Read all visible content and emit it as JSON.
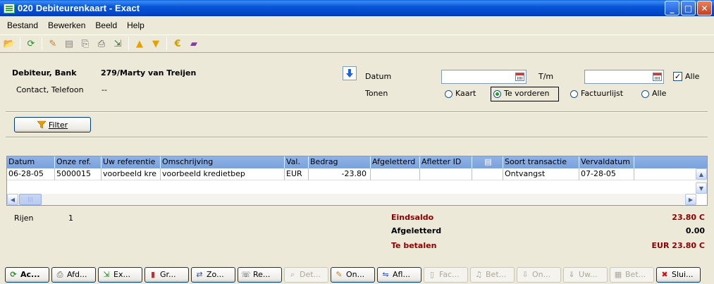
{
  "window": {
    "title": "020 Debiteurenkaart - Exact"
  },
  "menu": [
    "Bestand",
    "Bewerken",
    "Beeld",
    "Help"
  ],
  "header": {
    "debiteur_label": "Debiteur, Bank",
    "debiteur_value": "279/Marty van Treijen",
    "contact_label": "Contact, Telefoon",
    "contact_value": "--",
    "datum_label": "Datum",
    "tm_label": "T/m",
    "alle_checkbox_label": "Alle",
    "alle_checked": true,
    "tonen_label": "Tonen",
    "tonen_options": [
      "Kaart",
      "Te vorderen",
      "Factuurlijst",
      "Alle"
    ],
    "tonen_selected": "Te vorderen"
  },
  "filter_button": "Filter",
  "grid": {
    "columns": [
      "Datum",
      "Onze ref.",
      "Uw referentie",
      "Omschrijving",
      "Val.",
      "Bedrag",
      "Afgeletterd",
      "Afletter ID",
      "",
      "Soort transactie",
      "Vervaldatum"
    ],
    "rows": [
      [
        "06-28-05",
        "5000015",
        "voorbeeld kre",
        "voorbeeld kredietbep",
        "EUR",
        "-23.80",
        "",
        "",
        "",
        "Ontvangst",
        "07-28-05"
      ]
    ]
  },
  "summary": {
    "rijen_label": "Rijen",
    "rijen_value": "1",
    "eindsaldo_label": "Eindsaldo",
    "eindsaldo_value": "23.80 C",
    "afgeletterd_label": "Afgeletterd",
    "afgeletterd_value": "0.00",
    "te_betalen_label": "Te betalen",
    "te_betalen_value": "EUR 23.80 C"
  },
  "bottom_buttons": [
    "Ac...",
    "Afd...",
    "Ex...",
    "Gr...",
    "Zo...",
    "Re...",
    "Det...",
    "On...",
    "Afl...",
    "Fac...",
    "Bet...",
    "On...",
    "Uw...",
    "Bet...",
    "Slui..."
  ],
  "colors": {
    "title_bar": "#0054E3",
    "grid_header": "#8FB3E8",
    "summary_red": "#8B0000"
  }
}
